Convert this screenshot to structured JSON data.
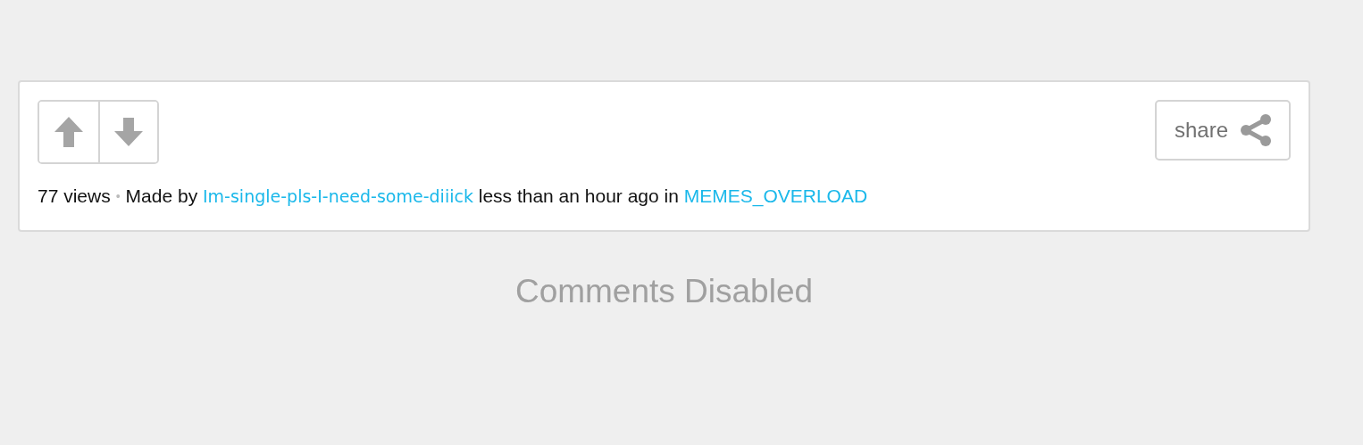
{
  "post": {
    "vote_buttons": [
      {
        "kind": "up"
      },
      {
        "kind": "down"
      }
    ],
    "share_button": {
      "label": "share"
    },
    "meta": {
      "views": "77 views",
      "separator": "•",
      "made_by": "Made by",
      "author": "Im-single-pls-I-need-some-diiick",
      "time": "less than an hour ago in",
      "stream": "MEMES_OVERLOAD"
    }
  },
  "comments_status": "Comments Disabled"
}
